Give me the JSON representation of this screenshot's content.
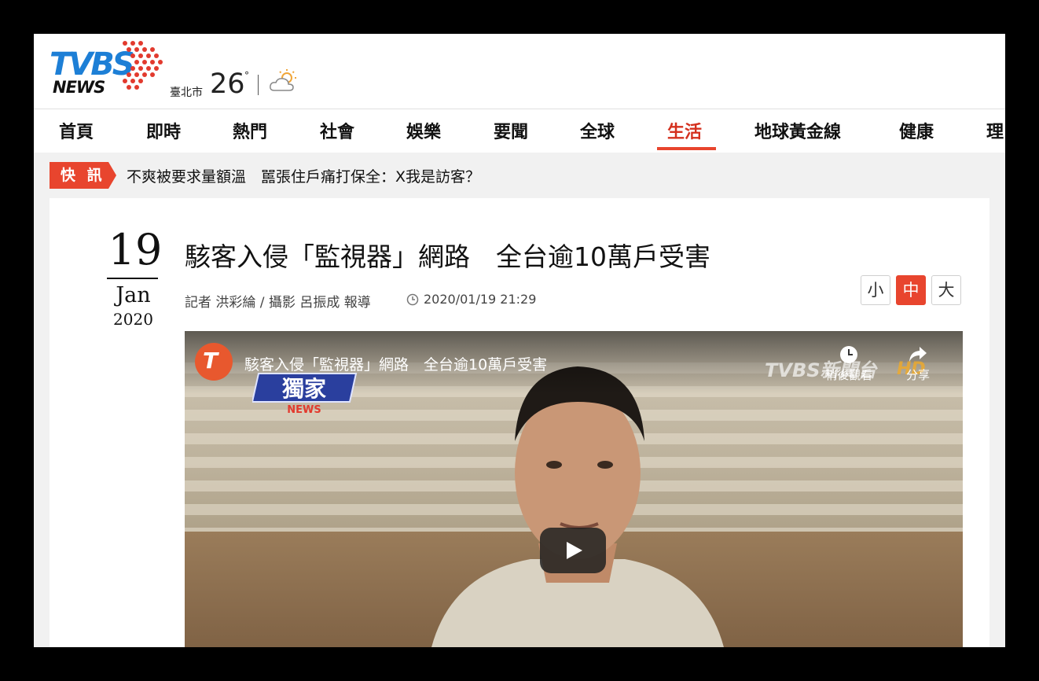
{
  "brand": {
    "logo_top": "TVBS",
    "logo_bottom": "NEWS"
  },
  "weather": {
    "city": "臺北市",
    "temperature": "26",
    "degree_symbol": "°",
    "icon": "partly-cloudy-icon"
  },
  "nav": {
    "items": [
      {
        "label": "首頁"
      },
      {
        "label": "即時"
      },
      {
        "label": "熱門"
      },
      {
        "label": "社會"
      },
      {
        "label": "娛樂"
      },
      {
        "label": "要聞"
      },
      {
        "label": "全球"
      },
      {
        "label": "生活",
        "active": true
      },
      {
        "label": "地球黃金線"
      },
      {
        "label": "健康"
      },
      {
        "label": "理"
      }
    ]
  },
  "ticker": {
    "badge": "快 訊",
    "text": "不爽被要求量額溫　嚚張住戶痛打保全：X我是訪客？"
  },
  "article": {
    "date": {
      "day": "19",
      "month": "Jan",
      "year": "2020"
    },
    "headline": "駭客入侵「監視器」網路　全台逾10萬戶受害",
    "byline": "記者 洪彩綸 / 攝影 呂振成 報導",
    "timestamp": "2020/01/19 21:29",
    "font_sizes": [
      {
        "label": "小"
      },
      {
        "label": "中",
        "active": true
      },
      {
        "label": "大"
      }
    ]
  },
  "video": {
    "title": "駭客入侵「監視器」網路　全台逾10萬戶受害",
    "channel_logo": "T",
    "badge_main": "獨家",
    "badge_sub": "NEWS",
    "watermark": "TVBS新聞台",
    "hd": "HD",
    "watch_later": "稍後觀看",
    "share": "分享"
  },
  "colors": {
    "accent": "#e8452e",
    "brand_blue": "#1d7fd6"
  }
}
